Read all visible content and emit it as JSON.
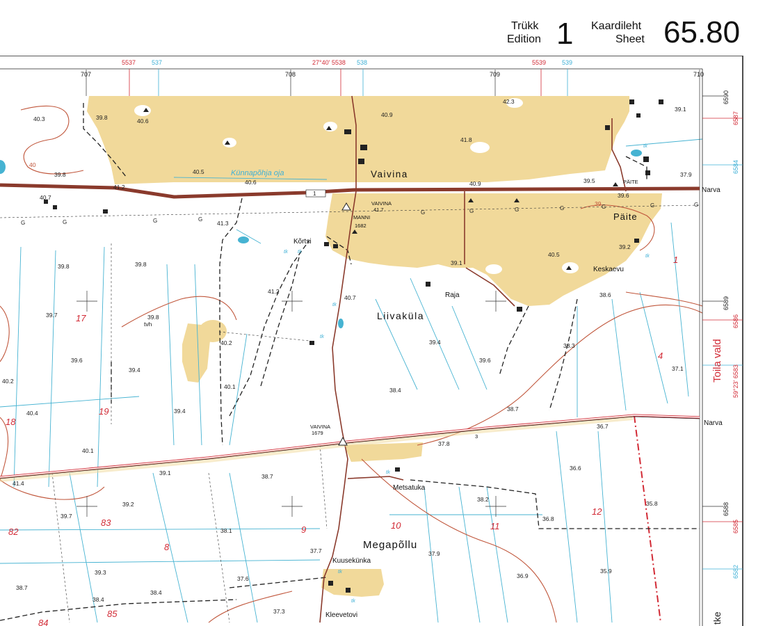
{
  "header": {
    "edition_et": "Trükk",
    "edition_en": "Edition",
    "edition_number": "1",
    "sheet_et": "Kaardileht",
    "sheet_en": "Sheet",
    "sheet_number": "65.80"
  },
  "grid_top": {
    "km_708": "708",
    "km_707": "707",
    "km_709": "709",
    "km_710": "710",
    "red_5537": "5537",
    "blue_537": "537",
    "red_5538": "27°40' 5538",
    "blue_538": "538",
    "red_5539": "5539",
    "blue_539": "539"
  },
  "grid_right": {
    "km_6590": "6590",
    "red_6587": "6587",
    "blue_6584": "6584",
    "km_6589": "6589",
    "red_6586": "6586",
    "red_6583": "59°23' 6583",
    "km_6588": "6588",
    "red_6585": "6585",
    "blue_6582": "6582"
  },
  "places": {
    "vaivina": "Vaivina",
    "liivakula": "Liivaküla",
    "megapollu": "Megapõllu",
    "paite": "Päite",
    "paite_caps": "PÄITE",
    "kortsi": "Kõrtsi",
    "raja": "Raja",
    "keskaevu": "Keskaevu",
    "metsatuka": "Metsatuka",
    "kuusekunka": "Kuusekünka",
    "kleevetovi": "Kleevetovi",
    "manni": "MANNI",
    "tvh": "tvh",
    "toila_vald": "Toila vald",
    "kunnapohja_oja": "Künnapõhja oja",
    "narva_top": "Narva",
    "narva_mid": "Narva",
    "road_number": "1",
    "tk": "tk",
    "g": "G",
    "edge_text": "tke"
  },
  "benchmarks": {
    "vaivina_top_name": "VAIVINA",
    "vaivina_top_value": "41.7",
    "manni_value": "1682",
    "vaivina_low_name": "VAIVINA",
    "vaivina_low_value": "1679",
    "point_3": "3"
  },
  "parcels": [
    "17",
    "18",
    "19",
    "83",
    "82",
    "8",
    "9",
    "10",
    "11",
    "12",
    "85",
    "84",
    "1",
    "4"
  ],
  "elevations": [
    "40.3",
    "39.8",
    "40.6",
    "40.9",
    "42.3",
    "39.1",
    "41.8",
    "40.5",
    "40.6",
    "39.8",
    "41.2",
    "40.7",
    "40.9",
    "39.5",
    "39.6",
    "37.9",
    "41.3",
    "39.8",
    "39.8",
    "39.1",
    "40.5",
    "39.2",
    "41.2",
    "40.7",
    "38.6",
    "39.7",
    "39.8",
    "39.4",
    "40.2",
    "38.3",
    "39.6",
    "39.4",
    "39.6",
    "40.2",
    "37.1",
    "40.1",
    "38.4",
    "39.4",
    "40.4",
    "38.7",
    "36.7",
    "37.8",
    "40.1",
    "39.1",
    "38.7",
    "36.6",
    "41.4",
    "39.2",
    "38.2",
    "39.7",
    "38.1",
    "36.8",
    "35.8",
    "37.7",
    "37.9",
    "39.3",
    "37.6",
    "36.9",
    "35.9",
    "38.7",
    "38.4",
    "38.4",
    "37.3",
    "40",
    "39"
  ],
  "colors": {
    "field": "#f1d99a",
    "road": "#8a3a2c",
    "contour": "#c0563b",
    "water": "#46b3d2",
    "grid": "#333333",
    "red_grid": "#d22b36",
    "blue_grid": "#3fb0d6",
    "parcel_number": "#d22b36"
  }
}
